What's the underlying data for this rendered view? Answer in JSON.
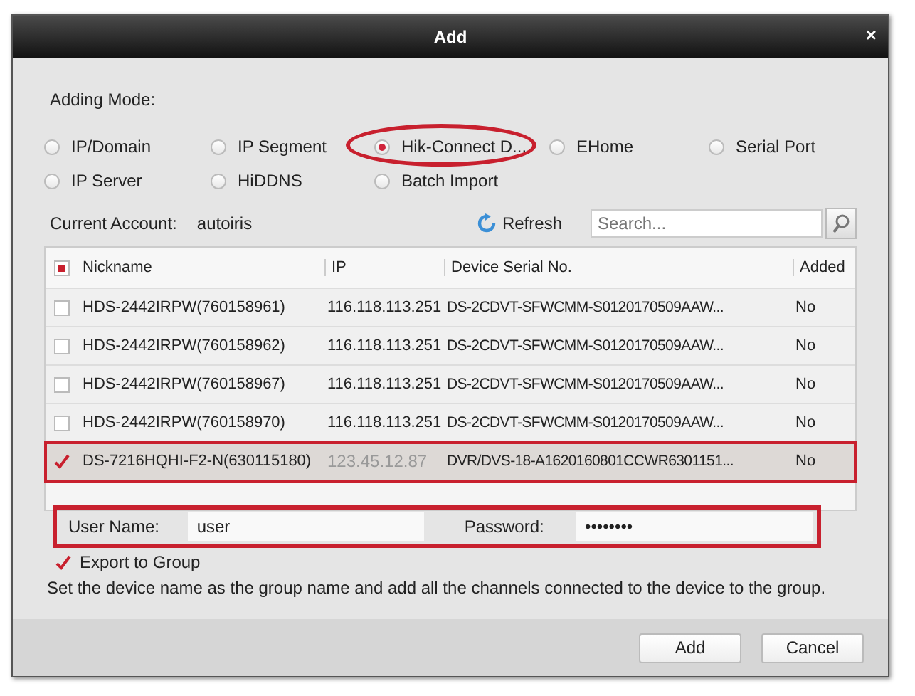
{
  "window": {
    "title": "Add",
    "close": "×"
  },
  "adding_mode": {
    "label": "Adding Mode:",
    "options": [
      {
        "label": "IP/Domain",
        "selected": false,
        "annotated": false
      },
      {
        "label": "IP Segment",
        "selected": false,
        "annotated": false
      },
      {
        "label": "Hik-Connect D...",
        "selected": true,
        "annotated": true
      },
      {
        "label": "EHome",
        "selected": false,
        "annotated": false
      },
      {
        "label": "Serial Port",
        "selected": false,
        "annotated": false
      },
      {
        "label": "IP Server",
        "selected": false,
        "annotated": false
      },
      {
        "label": "HiDDNS",
        "selected": false,
        "annotated": false
      },
      {
        "label": "Batch Import",
        "selected": false,
        "annotated": false
      }
    ]
  },
  "account": {
    "label": "Current Account:",
    "value": "autoiris"
  },
  "refresh": "Refresh",
  "search": {
    "placeholder": "Search..."
  },
  "table": {
    "header_checked": true,
    "columns": [
      "Nickname",
      "IP",
      "Device Serial No.",
      "Added"
    ],
    "rows": [
      {
        "checked": false,
        "annotated": false,
        "cells": [
          "HDS-2442IRPW(760158961)",
          "116.118.113.251",
          "DS-2CDVT-SFWCMM-S0120170509AAW...",
          "No"
        ]
      },
      {
        "checked": false,
        "annotated": false,
        "cells": [
          "HDS-2442IRPW(760158962)",
          "116.118.113.251",
          "DS-2CDVT-SFWCMM-S0120170509AAW...",
          "No"
        ]
      },
      {
        "checked": false,
        "annotated": false,
        "cells": [
          "HDS-2442IRPW(760158967)",
          "116.118.113.251",
          "DS-2CDVT-SFWCMM-S0120170509AAW...",
          "No"
        ]
      },
      {
        "checked": false,
        "annotated": false,
        "cells": [
          "HDS-2442IRPW(760158970)",
          "116.118.113.251",
          "DS-2CDVT-SFWCMM-S0120170509AAW...",
          "No"
        ]
      },
      {
        "checked": true,
        "annotated": true,
        "cells": [
          "DS-7216HQHI-F2-N(630115180)",
          "123.45.12.87",
          "DVR/DVS-18-A1620160801CCWR6301151...",
          "No"
        ]
      }
    ]
  },
  "credentials": {
    "annotated": true,
    "user_label": "User Name:",
    "user_value": "user",
    "password_label": "Password:",
    "password_value": "••••••••"
  },
  "export": {
    "label": "Export to Group",
    "checked": true
  },
  "note": "Set the device name as the group name and add all the channels connected to the device to the group.",
  "buttons": [
    "Add",
    "Cancel"
  ]
}
